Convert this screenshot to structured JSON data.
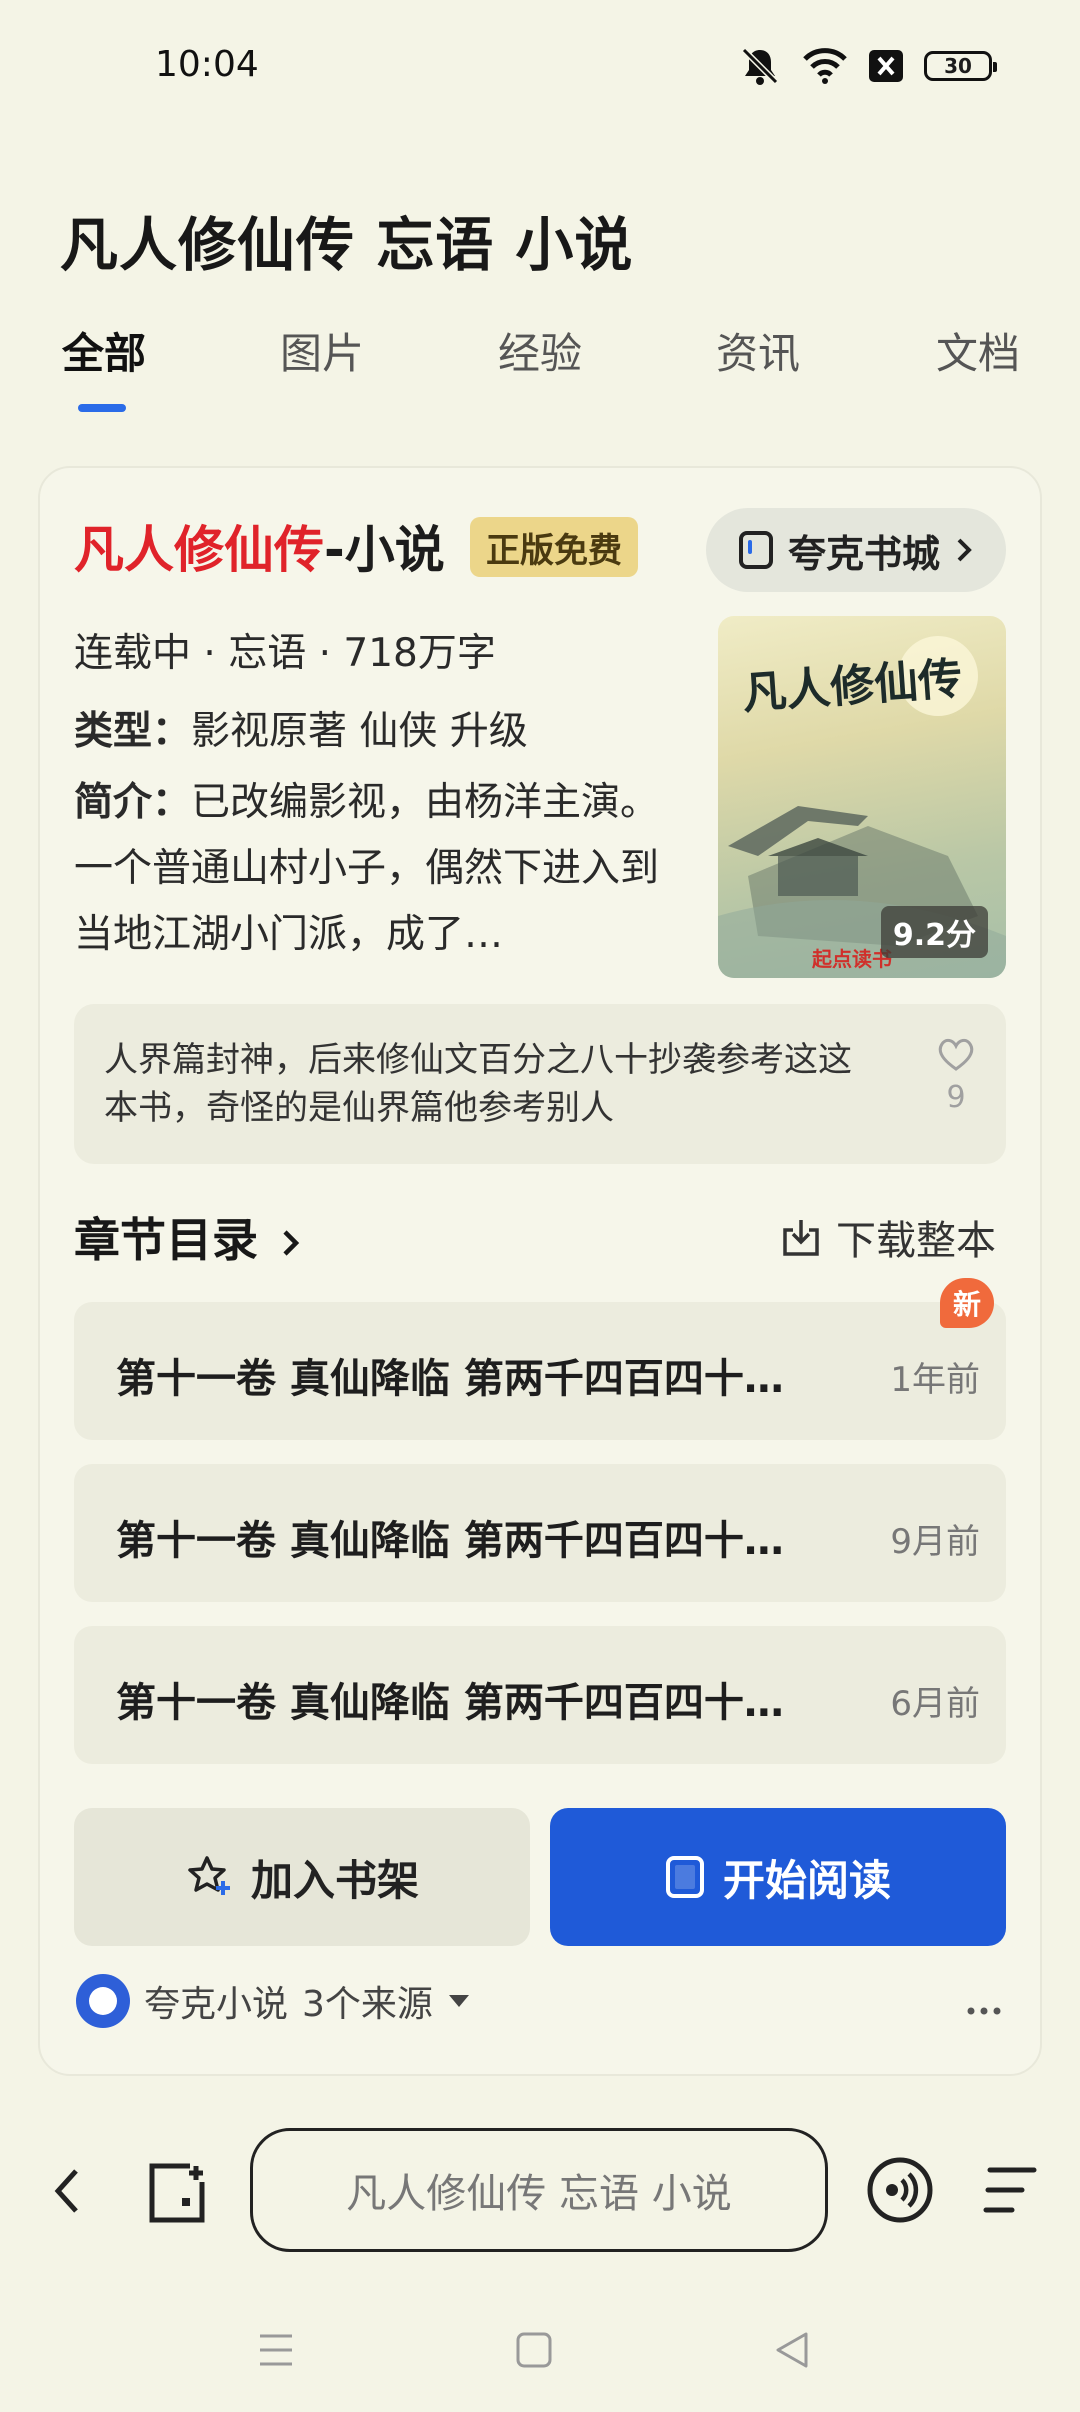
{
  "status_bar": {
    "time": "10:04",
    "battery": "30"
  },
  "query_title": "凡人修仙传 忘语 小说",
  "tabs": [
    {
      "label": "全部",
      "active": true
    },
    {
      "label": "图片"
    },
    {
      "label": "经验"
    },
    {
      "label": "资讯"
    },
    {
      "label": "文档"
    }
  ],
  "book": {
    "title_main": "凡人修仙传",
    "title_suffix": "-小说",
    "badge": "正版免费",
    "store_button": "夸克书城",
    "meta": "连载中 · 忘语 · 718万字",
    "type_label": "类型：",
    "type_value": "影视原著 仙侠 升级",
    "summary_label": "简介：",
    "summary_text": "已改编影视，由杨洋主演。一个普通山村小子，偶然下进入到当地江湖小门派，成了…",
    "cover_title": "凡人修仙传",
    "score": "9.2分",
    "cover_brand": "起点读书"
  },
  "comment": {
    "text": "人界篇封神，后来修仙文百分之八十抄袭参考这这本书，奇怪的是仙界篇他参考别人",
    "likes": "9"
  },
  "chapters": {
    "header": "章节目录",
    "download": "下载整本",
    "new_badge": "新",
    "items": [
      {
        "title": "第十一卷 真仙降临 第两千四百四十…",
        "time": "1年前"
      },
      {
        "title": "第十一卷 真仙降临 第两千四百四十…",
        "time": "9月前"
      },
      {
        "title": "第十一卷 真仙降临 第两千四百四十…",
        "time": "6月前"
      }
    ]
  },
  "actions": {
    "add_shelf": "加入书架",
    "start_reading": "开始阅读"
  },
  "source": {
    "name": "夸克小说",
    "count": "3个来源"
  },
  "bottom_bar": {
    "search_text": "凡人修仙传 忘语 小说"
  }
}
